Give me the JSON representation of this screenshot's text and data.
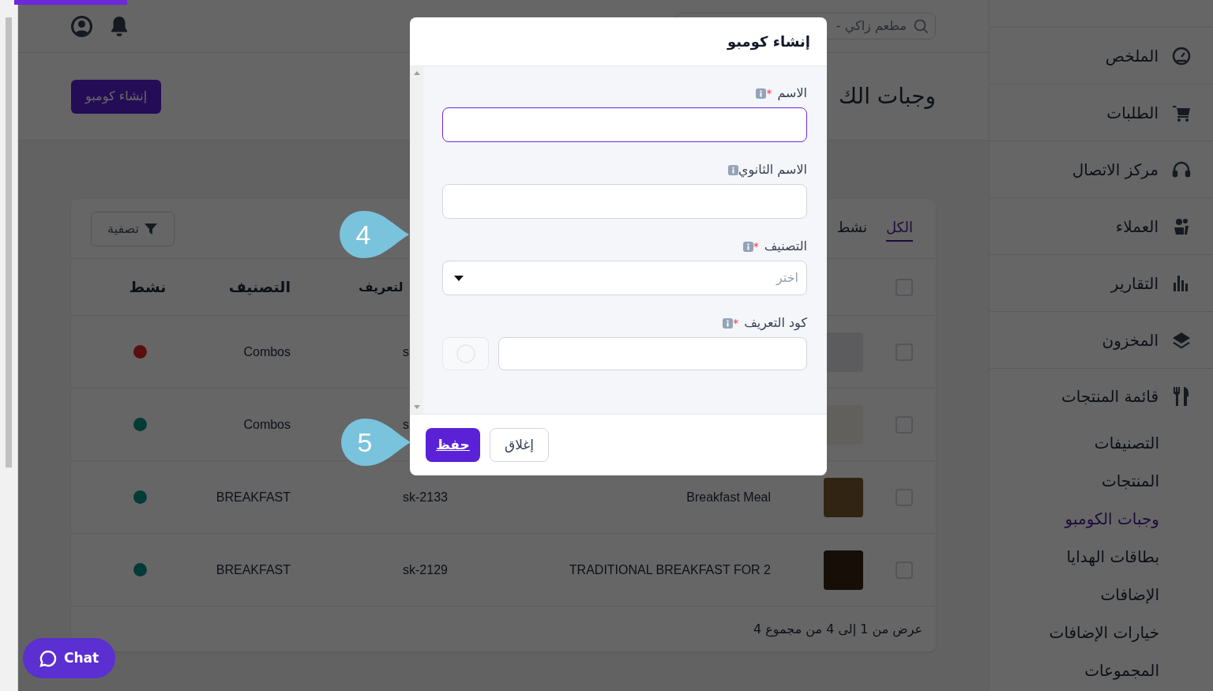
{
  "loading_bar": {
    "level": 0.093
  },
  "sidebar": {
    "items": [
      {
        "label": "الملخص",
        "expanded": false
      },
      {
        "label": "الطلبات",
        "expanded": false
      },
      {
        "label": "مركز الاتصال",
        "expanded": false
      },
      {
        "label": "العملاء",
        "expanded": false
      },
      {
        "label": "التقارير",
        "expanded": false
      },
      {
        "label": "المخزون",
        "expanded": false
      },
      {
        "label": "قائمة المنتجات",
        "expanded": true,
        "children": [
          {
            "label": "التصنيفات",
            "selected": false
          },
          {
            "label": "المنتجات",
            "selected": false
          },
          {
            "label": "وجبات الكومبو",
            "selected": true
          },
          {
            "label": "بطاقات الهدايا",
            "selected": false
          },
          {
            "label": "الإضافات",
            "selected": false
          },
          {
            "label": "خيارات الإضافات",
            "selected": false
          },
          {
            "label": "المجموعات",
            "selected": false
          }
        ]
      }
    ]
  },
  "header": {
    "search": {
      "value": "مطعم زاكي -"
    }
  },
  "page": {
    "title": "وجبات الك",
    "create_button": "إنشاء كومبو"
  },
  "table": {
    "tabs": [
      {
        "label": "الكل",
        "selected": true
      },
      {
        "label": "نشط",
        "selected": false
      }
    ],
    "filter_button": "تصفية",
    "header_checked": false,
    "columns": [
      "لتعريف",
      "التصنيف",
      "نشط"
    ],
    "rows": [
      {
        "checked": false,
        "has_photo": false,
        "code": "s",
        "category": "Combos",
        "active": false
      },
      {
        "checked": false,
        "has_photo": true,
        "code": "s",
        "category": "Combos",
        "active": true
      },
      {
        "checked": false,
        "has_photo": true,
        "name": "Breakfast Meal",
        "code": "sk-2133",
        "category": "BREAKFAST",
        "active": true
      },
      {
        "checked": false,
        "has_photo": true,
        "name": "TRADITIONAL BREAKFAST FOR 2",
        "code": "sk-2129",
        "category": "BREAKFAST",
        "active": true
      }
    ],
    "pagination": "عرض من 1 إلى 4 من مجموع 4"
  },
  "modal": {
    "title": "إنشاء كومبو",
    "required_mark": "*",
    "fields": [
      {
        "label": "الاسم",
        "required": true,
        "kind": "text",
        "focused": true
      },
      {
        "label": "الاسم الثانوي",
        "required": false,
        "kind": "text",
        "focused": false
      },
      {
        "label": "التصنيف",
        "required": true,
        "kind": "select",
        "placeholder": "اختر",
        "focused": false
      },
      {
        "label": "كود التعريف",
        "required": true,
        "kind": "code",
        "focused": false
      }
    ],
    "buttons": [
      {
        "label": "إغلاق",
        "kind": "secondary"
      },
      {
        "label": "حفظ",
        "kind": "primary"
      }
    ]
  },
  "callouts": [
    {
      "number": "4"
    },
    {
      "number": "5"
    }
  ],
  "chat_button": "Chat"
}
